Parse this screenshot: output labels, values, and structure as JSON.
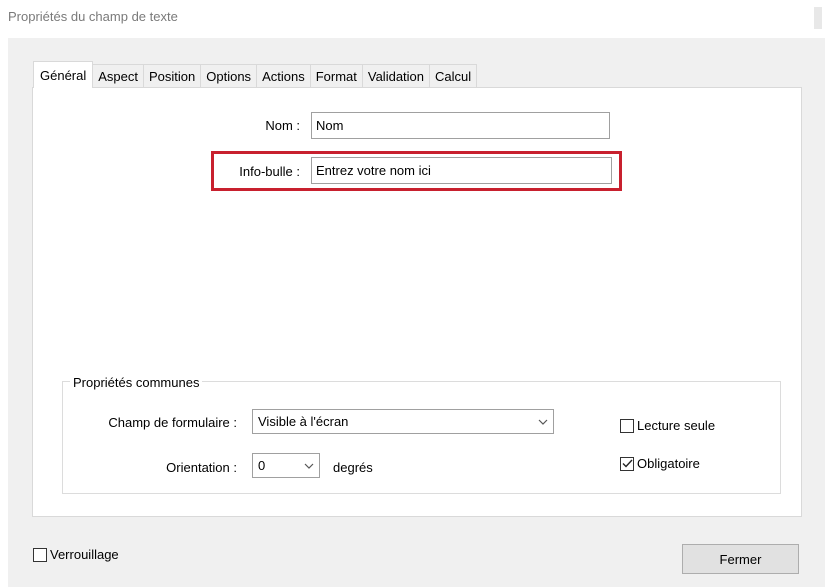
{
  "window": {
    "title": "Propriétés du champ de texte"
  },
  "tabs": [
    {
      "label": "Général",
      "active": true
    },
    {
      "label": "Aspect"
    },
    {
      "label": "Position"
    },
    {
      "label": "Options"
    },
    {
      "label": "Actions"
    },
    {
      "label": "Format"
    },
    {
      "label": "Validation"
    },
    {
      "label": "Calcul"
    }
  ],
  "general": {
    "name_label": "Nom :",
    "name_value": "Nom",
    "tooltip_label": "Info-bulle :",
    "tooltip_value": "Entrez votre nom ici"
  },
  "common": {
    "legend": "Propriétés communes",
    "form_field_label": "Champ de formulaire :",
    "form_field_value": "Visible à l'écran",
    "orientation_label": "Orientation :",
    "orientation_value": "0",
    "orientation_unit": "degrés",
    "read_only_label": "Lecture seule",
    "read_only_checked": false,
    "required_label": "Obligatoire",
    "required_checked": true
  },
  "footer": {
    "locked_label": "Verrouillage",
    "locked_checked": false,
    "close_label": "Fermer"
  },
  "colors": {
    "highlight": "#c8202e",
    "panel_bg": "#ffffff",
    "dialog_bg": "#f0f0f0"
  }
}
